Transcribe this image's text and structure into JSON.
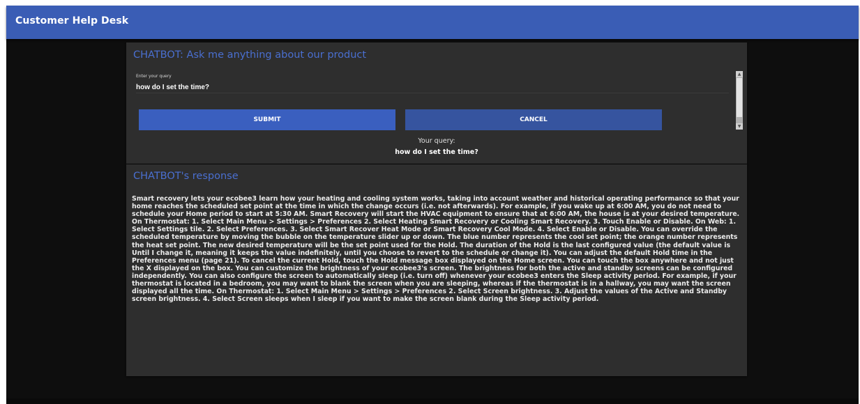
{
  "app": {
    "title": "Customer Help Desk"
  },
  "query_panel": {
    "title": "CHATBOT: Ask me anything about our product",
    "input_label": "Enter your query",
    "input_value": "how do I set the time?",
    "submit_label": "SUBMIT",
    "cancel_label": "CANCEL",
    "your_query_label": "Your query:",
    "your_query_value": "how do I set the time?"
  },
  "response_panel": {
    "title": "CHATBOT's response",
    "text": "Smart recovery lets your ecobee3 learn how your heating and cooling system works, taking into account weather and historical operating performance so that your home reaches the scheduled set point at the time in which the change occurs (i.e. not afterwards). For example, if you wake up at 6:00 AM, you do not need to schedule your Home period to start at 5:30 AM. Smart Recovery will start the HVAC equipment to ensure that at 6:00 AM, the house is at your desired temperature. On Thermostat: 1. Select Main Menu > Settings > Preferences 2. Select Heating Smart Recovery or Cooling Smart Recovery. 3. Touch Enable or Disable. On Web: 1. Select Settings tile. 2. Select Preferences. 3. Select Smart Recover Heat Mode or Smart Recovery Cool Mode. 4. Select Enable or Disable. You can override the scheduled temperature by moving the bubble on the temperature slider up or down. The blue number represents the cool set point; the orange number represents the heat set point. The new desired temperature will be the set point used for the Hold. The duration of the Hold is the last configured value (the default value is Until I change it, meaning it keeps the value indefinitely, until you choose to revert to the schedule or change it). You can adjust the default Hold time in the Preferences menu (page 21). To cancel the current Hold, touch the Hold message box displayed on the Home screen. You can touch the box anywhere and not just the X displayed on the box. You can customize the brightness of your ecobee3's screen. The brightness for both the active and standby screens can be configured independently. You can also configure the screen to automatically sleep (i.e. turn off) whenever your ecobee3 enters the Sleep activity period. For example, if your thermostat is located in a bedroom, you may want to blank the screen when you are sleeping, whereas if the thermostat is in a hallway, you may want the screen displayed all the time. On Thermostat: 1. Select Main Menu > Settings > Preferences 2. Select Screen brightness. 3. Adjust the values of the Active and Standby screen brightness. 4. Select Screen sleeps when I sleep if you want to make the screen blank during the Sleep activity period."
  },
  "colors": {
    "header": "#3a5db5",
    "accent_title": "#4a6fd0",
    "button": "#3a5fbf",
    "background": "#0e0e0e",
    "panel": "#2e2e2e"
  },
  "icons": {
    "scroll_up": "scroll-up-arrow-icon",
    "scroll_down": "scroll-down-arrow-icon"
  }
}
